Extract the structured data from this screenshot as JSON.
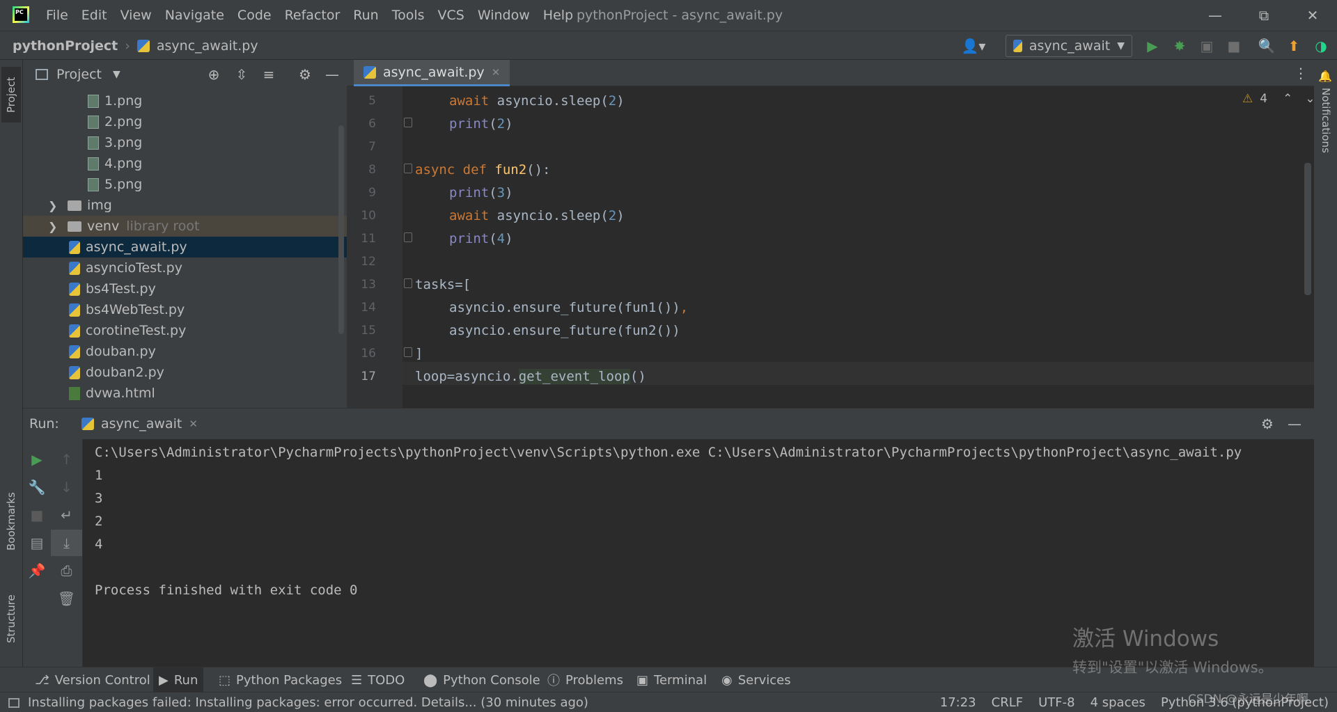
{
  "menu": [
    "File",
    "Edit",
    "View",
    "Navigate",
    "Code",
    "Refactor",
    "Run",
    "Tools",
    "VCS",
    "Window",
    "Help"
  ],
  "window_title": "pythonProject - async_await.py",
  "logo_text": "PC",
  "breadcrumb": {
    "project": "pythonProject",
    "file": "async_await.py"
  },
  "run_config": "async_await",
  "left_stripe": {
    "project": "Project",
    "bookmarks": "Bookmarks",
    "structure": "Structure"
  },
  "right_stripe": {
    "notifications": "Notifications"
  },
  "project_panel": {
    "title": "Project",
    "items": [
      {
        "label": "1.png",
        "dim": ""
      },
      {
        "label": "2.png",
        "dim": ""
      },
      {
        "label": "3.png",
        "dim": ""
      },
      {
        "label": "4.png",
        "dim": ""
      },
      {
        "label": "5.png",
        "dim": ""
      },
      {
        "label": "img",
        "dim": ""
      },
      {
        "label": "venv",
        "dim": "library root"
      },
      {
        "label": "async_await.py",
        "dim": ""
      },
      {
        "label": "asyncioTest.py",
        "dim": ""
      },
      {
        "label": "bs4Test.py",
        "dim": ""
      },
      {
        "label": "bs4WebTest.py",
        "dim": ""
      },
      {
        "label": "corotineTest.py",
        "dim": ""
      },
      {
        "label": "douban.py",
        "dim": ""
      },
      {
        "label": "douban2.py",
        "dim": ""
      },
      {
        "label": "dvwa.html",
        "dim": ""
      }
    ]
  },
  "editor": {
    "tab": "async_await.py",
    "warnings": "4",
    "line_numbers": [
      "5",
      "6",
      "7",
      "8",
      "9",
      "10",
      "11",
      "12",
      "13",
      "14",
      "15",
      "16",
      "17"
    ],
    "code": {
      "l5_kw": "await",
      "l5_rest": " asyncio.sleep(",
      "l5_num": "2",
      "l5_end": ")",
      "l6_bi": "print",
      "l6_open": "(",
      "l6_num": "2",
      "l6_end": ")",
      "l8_kw1": "async",
      "l8_kw2": " def ",
      "l8_fn": "fun2",
      "l8_end": "():",
      "l9_bi": "print",
      "l9_open": "(",
      "l9_num": "3",
      "l9_end": ")",
      "l10_kw": "await",
      "l10_rest": " asyncio.sleep(",
      "l10_num": "2",
      "l10_end": ")",
      "l11_bi": "print",
      "l11_open": "(",
      "l11_num": "4",
      "l11_end": ")",
      "l13": "tasks=[",
      "l14_a": "asyncio.ensure_future(fun1())",
      "l14_b": ",",
      "l15": "asyncio.ensure_future(fun2())",
      "l16": "]",
      "l17_a": "loop=asyncio.",
      "l17_b": "get_event_loop",
      "l17_c": "()"
    }
  },
  "run_panel": {
    "label": "Run:",
    "tab": "async_await",
    "output": [
      "C:\\Users\\Administrator\\PycharmProjects\\pythonProject\\venv\\Scripts\\python.exe C:\\Users\\Administrator\\PycharmProjects\\pythonProject\\async_await.py",
      "1",
      "3",
      "2",
      "4",
      "",
      "Process finished with exit code 0"
    ]
  },
  "bottom_tools": [
    "Version Control",
    "Run",
    "Python Packages",
    "TODO",
    "Python Console",
    "Problems",
    "Terminal",
    "Services"
  ],
  "status": {
    "message": "Installing packages failed: Installing packages: error occurred. Details... (30 minutes ago)",
    "position": "17:23",
    "line_sep": "CRLF",
    "encoding": "UTF-8",
    "indent": "4 spaces",
    "interpreter": "Python 3.6 (pythonProject)"
  },
  "watermark": {
    "title": "激活 Windows",
    "subtitle": "转到\"设置\"以激活 Windows。",
    "credit": "CSDN @永远是少年啊"
  },
  "colors": {
    "accent": "#4a88c7",
    "run_green": "#499c54",
    "keyword": "#cc7832",
    "function": "#ffc66d",
    "builtin": "#8888c6",
    "number": "#6897bb"
  }
}
